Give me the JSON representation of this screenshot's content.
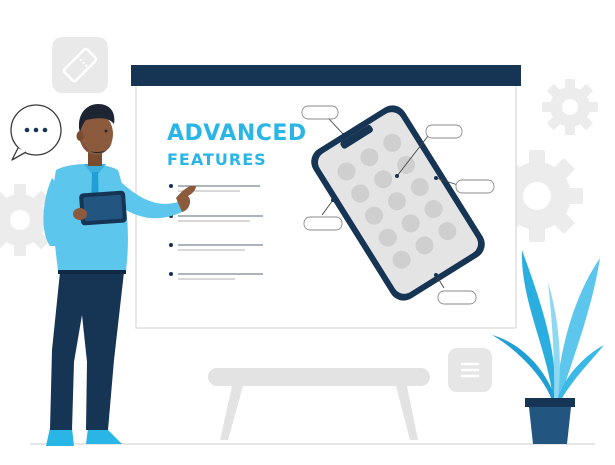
{
  "slide": {
    "title_line1": "ADVANCED",
    "title_line2": "FEATURES"
  },
  "colors": {
    "accent": "#29b5e6",
    "navy": "#163454",
    "light_gray": "#eaeaea",
    "mid_gray": "#d8d8d8"
  },
  "icons": [
    "ticket-icon",
    "chat-bubble-icon",
    "gear-icon",
    "menu-icon",
    "plant-icon"
  ]
}
